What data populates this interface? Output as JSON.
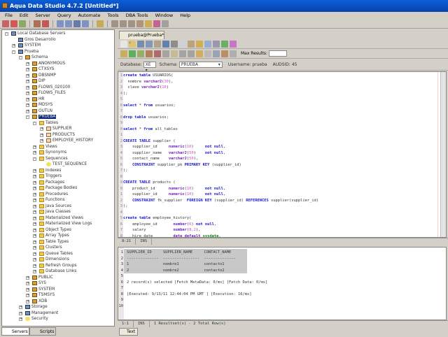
{
  "window": {
    "title": "Aqua Data Studio 4.7.2 [Untitled*]"
  },
  "menu": [
    "File",
    "Edit",
    "Server",
    "Query",
    "Automate",
    "Tools",
    "DBA Tools",
    "Window",
    "Help"
  ],
  "tree": [
    {
      "d": 0,
      "label": "Local Database Servers",
      "icon": "server",
      "exp": "-"
    },
    {
      "d": 1,
      "label": "Gros Desarrollo",
      "icon": "server",
      "exp": ""
    },
    {
      "d": 1,
      "label": "SYSTEM",
      "icon": "server",
      "exp": "+"
    },
    {
      "d": 1,
      "label": "Prueba",
      "icon": "server",
      "exp": "-"
    },
    {
      "d": 2,
      "label": "Schema",
      "icon": "schema",
      "exp": "-"
    },
    {
      "d": 3,
      "label": "ANONYMOUS",
      "icon": "schema",
      "exp": "+"
    },
    {
      "d": 3,
      "label": "CTXSYS",
      "icon": "schema",
      "exp": "+"
    },
    {
      "d": 3,
      "label": "DBSNMP",
      "icon": "schema",
      "exp": "+"
    },
    {
      "d": 3,
      "label": "DIP",
      "icon": "schema",
      "exp": "+"
    },
    {
      "d": 3,
      "label": "FLOWS_020100",
      "icon": "schema",
      "exp": "+"
    },
    {
      "d": 3,
      "label": "FLOWS_FILES",
      "icon": "schema",
      "exp": "+"
    },
    {
      "d": 3,
      "label": "HR",
      "icon": "schema",
      "exp": "+"
    },
    {
      "d": 3,
      "label": "MDSYS",
      "icon": "schema",
      "exp": "+"
    },
    {
      "d": 3,
      "label": "OUTLN",
      "icon": "schema",
      "exp": "+"
    },
    {
      "d": 3,
      "label": "PRUEBA",
      "icon": "schema",
      "exp": "-",
      "selected": true
    },
    {
      "d": 4,
      "label": "Tables",
      "icon": "folder",
      "exp": "-"
    },
    {
      "d": 5,
      "label": "SUPPLIER",
      "icon": "table",
      "exp": "+"
    },
    {
      "d": 5,
      "label": "PRODUCTS",
      "icon": "table",
      "exp": "+"
    },
    {
      "d": 5,
      "label": "EMPLOYEE_HISTORY",
      "icon": "table",
      "exp": "+"
    },
    {
      "d": 4,
      "label": "Views",
      "icon": "folder",
      "exp": "+"
    },
    {
      "d": 4,
      "label": "Synonyms",
      "icon": "folder",
      "exp": "+"
    },
    {
      "d": 4,
      "label": "Sequences",
      "icon": "folder",
      "exp": "-"
    },
    {
      "d": 5,
      "label": "TEST_SEQUENCE",
      "icon": "seq",
      "exp": ""
    },
    {
      "d": 4,
      "label": "Indexes",
      "icon": "folder",
      "exp": "+"
    },
    {
      "d": 4,
      "label": "Triggers",
      "icon": "folder",
      "exp": "+"
    },
    {
      "d": 4,
      "label": "Packages",
      "icon": "folder",
      "exp": "+"
    },
    {
      "d": 4,
      "label": "Package Bodies",
      "icon": "folder",
      "exp": "+"
    },
    {
      "d": 4,
      "label": "Procedures",
      "icon": "folder",
      "exp": "+"
    },
    {
      "d": 4,
      "label": "Functions",
      "icon": "folder",
      "exp": "+"
    },
    {
      "d": 4,
      "label": "Java Sources",
      "icon": "folder",
      "exp": "+"
    },
    {
      "d": 4,
      "label": "Java Classes",
      "icon": "folder",
      "exp": "+"
    },
    {
      "d": 4,
      "label": "Materialized Views",
      "icon": "folder",
      "exp": "+"
    },
    {
      "d": 4,
      "label": "Materialized View Logs",
      "icon": "folder",
      "exp": "+"
    },
    {
      "d": 4,
      "label": "Object Types",
      "icon": "folder",
      "exp": "+"
    },
    {
      "d": 4,
      "label": "Array Types",
      "icon": "folder",
      "exp": "+"
    },
    {
      "d": 4,
      "label": "Table Types",
      "icon": "folder",
      "exp": "+"
    },
    {
      "d": 4,
      "label": "Clusters",
      "icon": "folder",
      "exp": "+"
    },
    {
      "d": 4,
      "label": "Queue Tables",
      "icon": "folder",
      "exp": "+"
    },
    {
      "d": 4,
      "label": "Dimensions",
      "icon": "folder",
      "exp": "+"
    },
    {
      "d": 4,
      "label": "Refresh Groups",
      "icon": "folder",
      "exp": "+"
    },
    {
      "d": 4,
      "label": "Database Links",
      "icon": "folder",
      "exp": "+"
    },
    {
      "d": 3,
      "label": "PUBLIC",
      "icon": "schema",
      "exp": "+"
    },
    {
      "d": 3,
      "label": "SYS",
      "icon": "schema",
      "exp": "+"
    },
    {
      "d": 3,
      "label": "SYSTEM",
      "icon": "schema",
      "exp": "+"
    },
    {
      "d": 3,
      "label": "TSMSYS",
      "icon": "schema",
      "exp": "+"
    },
    {
      "d": 3,
      "label": "XDB",
      "icon": "schema",
      "exp": "+"
    },
    {
      "d": 2,
      "label": "Storage",
      "icon": "server",
      "exp": "+"
    },
    {
      "d": 2,
      "label": "Management",
      "icon": "server",
      "exp": "+"
    },
    {
      "d": 2,
      "label": "Security",
      "icon": "seq",
      "exp": "+"
    }
  ],
  "left_tabs": {
    "servers": "Servers",
    "scripts": "Scripts"
  },
  "editor_tab": {
    "label": "prueba@Prueba*",
    "close": "×"
  },
  "query_toolbar": {
    "max_results_label": "Max Results:",
    "max_results_value": ""
  },
  "db_row": {
    "database_label": "Database:",
    "database_value": "XE",
    "schema_label": "Schema:",
    "schema_value": "PRUEBA",
    "username": "Username: prueba",
    "audsid": "AUDSID: 45"
  },
  "code": [
    [
      [
        "create table ",
        "k"
      ],
      [
        "USUARIOS(",
        "p"
      ]
    ],
    [
      [
        "  nombre ",
        "p"
      ],
      [
        "varchar2",
        "t"
      ],
      [
        "(",
        "p"
      ],
      [
        "30",
        "n"
      ],
      [
        "),",
        "p"
      ]
    ],
    [
      [
        "  clave ",
        "p"
      ],
      [
        "varchar2",
        "t"
      ],
      [
        "(",
        "p"
      ],
      [
        "10",
        "n"
      ],
      [
        ")",
        "p"
      ]
    ],
    [
      [
        ");",
        "p"
      ]
    ],
    [],
    [
      [
        "select ",
        "k"
      ],
      [
        "* ",
        "p"
      ],
      [
        "from ",
        "k"
      ],
      [
        "usuarios;",
        "p"
      ]
    ],
    [],
    [
      [
        "drop table ",
        "k"
      ],
      [
        "usuarios;",
        "p"
      ]
    ],
    [],
    [
      [
        "select ",
        "k"
      ],
      [
        "* ",
        "p"
      ],
      [
        "from ",
        "k"
      ],
      [
        "all_tables",
        "p"
      ]
    ],
    [],
    [
      [
        "CREATE TABLE ",
        "k"
      ],
      [
        "supplier (",
        "p"
      ]
    ],
    [
      [
        "    supplier_id     ",
        "p"
      ],
      [
        "numeric",
        "t"
      ],
      [
        "(",
        "p"
      ],
      [
        "10",
        "n"
      ],
      [
        ")     ",
        "p"
      ],
      [
        "not null",
        "k"
      ],
      [
        ",",
        "p"
      ]
    ],
    [
      [
        "    supplier_name   ",
        "p"
      ],
      [
        "varchar2",
        "t"
      ],
      [
        "(",
        "p"
      ],
      [
        "50",
        "n"
      ],
      [
        ")    ",
        "p"
      ],
      [
        "not null",
        "k"
      ],
      [
        ",",
        "p"
      ]
    ],
    [
      [
        "    contact_name    ",
        "p"
      ],
      [
        "varchar2",
        "t"
      ],
      [
        "(",
        "p"
      ],
      [
        "50",
        "n"
      ],
      [
        "),",
        "p"
      ]
    ],
    [
      [
        "    CONSTRAINT ",
        "k"
      ],
      [
        "supplier_pk ",
        "p"
      ],
      [
        "PRIMARY KEY ",
        "k"
      ],
      [
        "(supplier_id)",
        "p"
      ]
    ],
    [
      [
        ");",
        "p"
      ]
    ],
    [],
    [
      [
        "CREATE TABLE ",
        "k"
      ],
      [
        "products (",
        "p"
      ]
    ],
    [
      [
        "    product_id      ",
        "p"
      ],
      [
        "numeric",
        "t"
      ],
      [
        "(",
        "p"
      ],
      [
        "10",
        "n"
      ],
      [
        ")     ",
        "p"
      ],
      [
        "not null",
        "k"
      ],
      [
        ",",
        "p"
      ]
    ],
    [
      [
        "    supplier_id     ",
        "p"
      ],
      [
        "numeric",
        "t"
      ],
      [
        "(",
        "p"
      ],
      [
        "10",
        "n"
      ],
      [
        ")     ",
        "p"
      ],
      [
        "not null",
        "k"
      ],
      [
        ",",
        "p"
      ]
    ],
    [
      [
        "    CONSTRAINT ",
        "k"
      ],
      [
        "fk_supplier  ",
        "p"
      ],
      [
        "FOREIGN KEY ",
        "k"
      ],
      [
        "(supplier_id) ",
        "p"
      ],
      [
        "REFERENCES ",
        "k"
      ],
      [
        "supplier(supplier_id)",
        "p"
      ]
    ],
    [
      [
        ");",
        "p"
      ]
    ],
    [],
    [
      [
        "create table ",
        "k"
      ],
      [
        "employee_history(",
        "p"
      ]
    ],
    [
      [
        "    employee_id       ",
        "p"
      ],
      [
        "number",
        "t"
      ],
      [
        "(",
        "p"
      ],
      [
        "6",
        "n"
      ],
      [
        ") ",
        "p"
      ],
      [
        "not null",
        "k"
      ],
      [
        ",",
        "p"
      ]
    ],
    [
      [
        "    salary            ",
        "p"
      ],
      [
        "number",
        "t"
      ],
      [
        "(",
        "p"
      ],
      [
        "8,2",
        "n"
      ],
      [
        "),",
        "p"
      ]
    ],
    [
      [
        "    hire_date         ",
        "p"
      ],
      [
        "date default ",
        "t"
      ],
      [
        "sysdate",
        "g"
      ],
      [
        ",",
        "p"
      ]
    ]
  ],
  "editor_status": {
    "position": "8:21",
    "mode": "INS"
  },
  "results": {
    "lines": [
      "SUPPLIER_ID     SUPPLIER_NAME     CONTACT_NAME",
      "--------------  ----------------  --------------",
      "1               nombre1           contacto1",
      "2               nombre2           contacto2",
      "",
      "2 record(s) selected [Fetch MetaData: 0/ms] [Fetch Data: 0/ms]",
      "",
      "[Executed: 9/13/11 12:44:04 PM GMT ] [Execution: 16/ms]",
      "",
      ""
    ]
  },
  "results_status": {
    "position": "1:1",
    "mode": "INS",
    "summary": "1 Resultset(s) - 2 Total Row(s)"
  },
  "bottom_tab": {
    "text": "Text"
  }
}
